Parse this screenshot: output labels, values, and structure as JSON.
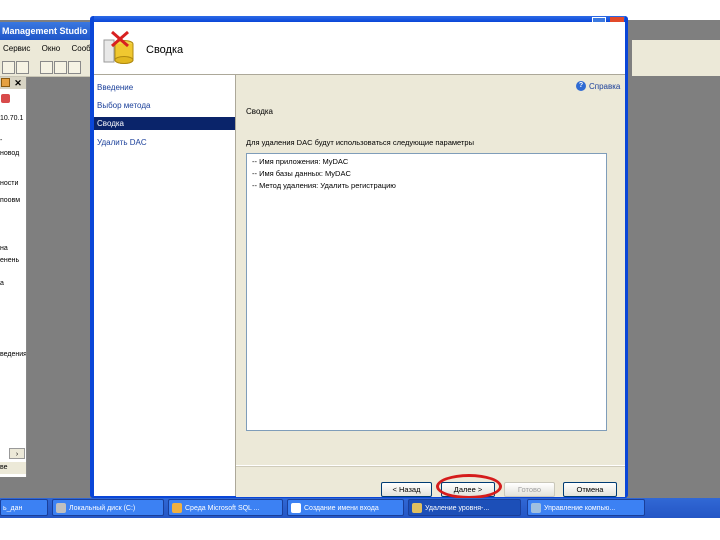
{
  "background_app": {
    "title": "Management Studio",
    "menu": [
      "Сервис",
      "Окно",
      "Сооб"
    ],
    "explorer_text": [
      "10.70.1",
      "-",
      "новод",
      "ности",
      "поовм",
      "на",
      "енень",
      "а",
      "ведения",
      "-",
      "ве"
    ]
  },
  "dialog": {
    "header_title": "Сводка",
    "help_label": "Справка",
    "nav": [
      {
        "label": "Введение",
        "selected": false
      },
      {
        "label": "Выбор метода",
        "selected": false
      },
      {
        "label": "Сводка",
        "selected": true
      },
      {
        "label": "Удалить DAC",
        "selected": false
      }
    ],
    "section_title": "Сводка",
    "description": "Для удаления DAC будут использоваться следующие параметры",
    "summary_items": [
      "-- Имя приложения: MyDAC",
      "-- Имя базы данных: MyDAC",
      "-- Метод удаления: Удалить регистрацию"
    ],
    "buttons": {
      "back": "< Назад",
      "next": "Далее >",
      "finish": "Готово",
      "cancel": "Отмена"
    }
  },
  "taskbar": {
    "items": [
      {
        "label": "ь_дан",
        "active": false,
        "icon_color": "#f0c040"
      },
      {
        "label": "Локальный диск (C:)",
        "active": false,
        "icon_color": "#c0c0c0"
      },
      {
        "label": "Среда Microsoft SQL ...",
        "active": false,
        "icon_color": "#f0b040"
      },
      {
        "label": "Создание имени входа",
        "active": false,
        "icon_color": "#ffffff"
      },
      {
        "label": "Удаление уровня-...",
        "active": true,
        "icon_color": "#e0c060"
      },
      {
        "label": "Управление компью...",
        "active": false,
        "icon_color": "#a0c0e0"
      }
    ]
  },
  "colors": {
    "accent": "#0a246a",
    "dialog_border": "#0a46d8",
    "highlight_ring": "#d51c1c"
  }
}
